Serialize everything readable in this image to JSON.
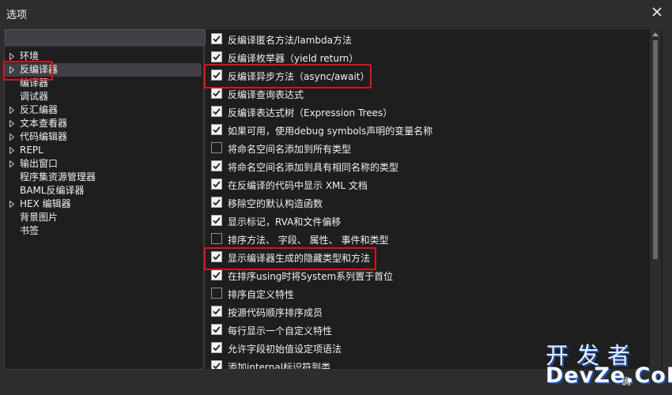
{
  "window": {
    "title": "选项"
  },
  "search": {
    "placeholder": ""
  },
  "tree": [
    {
      "label": "环境",
      "expandable": true,
      "selected": false
    },
    {
      "label": "反编译器",
      "expandable": true,
      "selected": true
    },
    {
      "label": "编译器",
      "expandable": false,
      "selected": false
    },
    {
      "label": "调试器",
      "expandable": false,
      "selected": false
    },
    {
      "label": "反汇编器",
      "expandable": true,
      "selected": false
    },
    {
      "label": "文本查看器",
      "expandable": true,
      "selected": false
    },
    {
      "label": "代码编辑器",
      "expandable": true,
      "selected": false
    },
    {
      "label": "REPL",
      "expandable": true,
      "selected": false
    },
    {
      "label": "输出窗口",
      "expandable": true,
      "selected": false
    },
    {
      "label": "程序集资源管理器",
      "expandable": false,
      "selected": false
    },
    {
      "label": "BAML反编译器",
      "expandable": false,
      "selected": false
    },
    {
      "label": "HEX 编辑器",
      "expandable": true,
      "selected": false
    },
    {
      "label": "背景图片",
      "expandable": false,
      "selected": false
    },
    {
      "label": "书签",
      "expandable": false,
      "selected": false
    }
  ],
  "options": [
    {
      "label": "反编译匿名方法/lambda方法",
      "checked": true
    },
    {
      "label": "反编译枚举器（yield return）",
      "checked": true
    },
    {
      "label": "反编译异步方法（async/await）",
      "checked": true
    },
    {
      "label": "反编译查询表达式",
      "checked": true
    },
    {
      "label": "反编译表达式树（Expression Trees）",
      "checked": true
    },
    {
      "label": "如果可用，使用debug symbols声明的变量名称",
      "checked": true
    },
    {
      "label": "将命名空间名添加到所有类型",
      "checked": false
    },
    {
      "label": "将命名空间名添加到具有相同名称的类型",
      "checked": true
    },
    {
      "label": "在反编译的代码中显示 XML 文档",
      "checked": true
    },
    {
      "label": "移除空的默认构造函数",
      "checked": true
    },
    {
      "label": "显示标记，RVA和文件偏移",
      "checked": true
    },
    {
      "label": "排序方法、 字段、 属性、 事件和类型",
      "checked": false
    },
    {
      "label": "显示编译器生成的隐藏类型和方法",
      "checked": true
    },
    {
      "label": "在排序using时将System系列置于首位",
      "checked": true
    },
    {
      "label": "排序自定义特性",
      "checked": false
    },
    {
      "label": "按源代码顺序排序成员",
      "checked": true
    },
    {
      "label": "每行显示一个自定义特性",
      "checked": true
    },
    {
      "label": "允许字段初始值设定项语法",
      "checked": true
    },
    {
      "label": "添加internal标识符到类",
      "checked": true
    }
  ],
  "highlighted": [
    "反编译器",
    "反编译异步方法（async/await）",
    "显示编译器生成的隐藏类型和方法"
  ],
  "watermark": {
    "cn": "开发者",
    "en": "DevZe.CoM"
  },
  "footer": {
    "ok_label": "确"
  },
  "colors": {
    "highlight": "#e0101a",
    "background": "#2d2d30",
    "panel": "#1e1e1e"
  }
}
